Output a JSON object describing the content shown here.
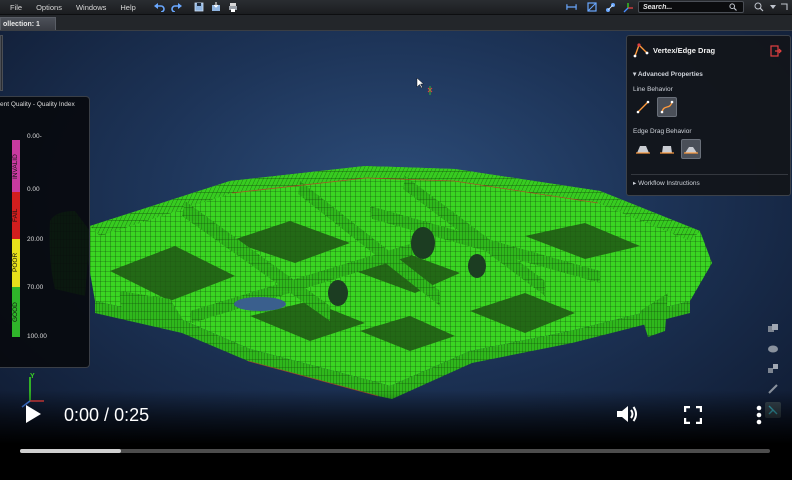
{
  "menubar": {
    "items": [
      "File",
      "Options",
      "Windows",
      "Help"
    ],
    "search_placeholder": "Search..."
  },
  "tabs": [
    {
      "label": "ollection: 1"
    }
  ],
  "legend": {
    "title": "ent Quality - Quality Index",
    "bands": [
      {
        "label": "INVALID",
        "color": "#c83aa0"
      },
      {
        "label": "FAIL",
        "color": "#d11e1e"
      },
      {
        "label": "POOR",
        "color": "#e7e01b"
      },
      {
        "label": "GOOD",
        "color": "#2fb52a"
      }
    ],
    "values": [
      "0.00-",
      "0.00",
      "20.00",
      "70.00",
      "100.00"
    ]
  },
  "panel": {
    "title": "Vertex/Edge Drag",
    "advanced_properties": "Advanced Properties",
    "line_behavior": "Line Behavior",
    "edge_drag_behavior": "Edge Drag Behavior",
    "workflow_instructions": "Workflow Instructions"
  },
  "axis": {
    "y": "Y"
  },
  "video": {
    "current_time": "0:00",
    "separator": " / ",
    "duration": "0:25",
    "progress_fraction": 0.135
  },
  "colors": {
    "mesh": "#3ad622",
    "background": "#1d3458",
    "accent": "#e24040"
  },
  "icons": [
    "undo-icon",
    "redo-icon",
    "save-icon",
    "import-icon",
    "print-icon",
    "search-icon",
    "help-icon",
    "play-icon",
    "volume-icon",
    "fullscreen-icon",
    "more-icon"
  ]
}
